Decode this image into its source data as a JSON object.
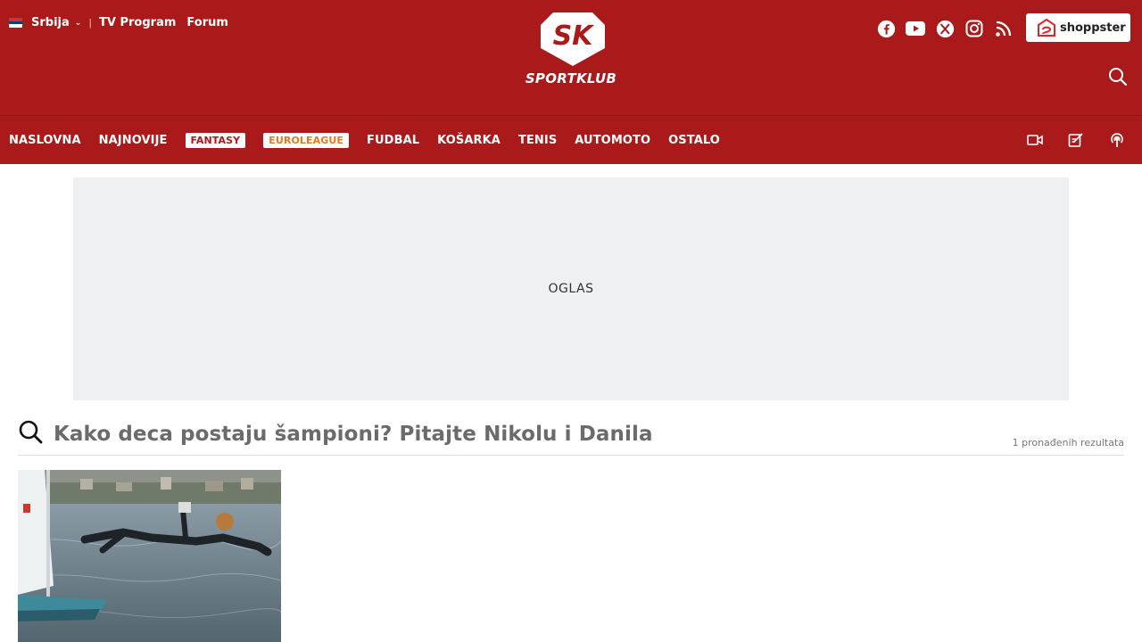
{
  "header": {
    "country": "Srbija",
    "country_flag": "serbia-flag-icon",
    "links": [
      "TV Program",
      "Forum"
    ],
    "logo_badge": "SK",
    "logo_text": "SPORTKLUB",
    "social_icons": [
      "facebook-icon",
      "youtube-icon",
      "x-icon",
      "instagram-icon",
      "rss-icon"
    ],
    "shop_label": "shoppster",
    "brand_color": "#ab1a1a"
  },
  "nav": {
    "items": [
      "NASLOVNA",
      "NAJNOVIJE",
      "FANTASY",
      "EUROLEAGUE",
      "FUDBAL",
      "KOŠARKA",
      "TENIS",
      "AUTOMOTO",
      "OSTALO"
    ],
    "icons": [
      "video-icon",
      "edit-icon",
      "podcast-icon"
    ]
  },
  "ad": {
    "label": "OGLAS"
  },
  "results": {
    "query": "Kako deca postaju šampioni? Pitajte Nikolu i Danila",
    "count_label": "1 pronađenih rezultata"
  }
}
